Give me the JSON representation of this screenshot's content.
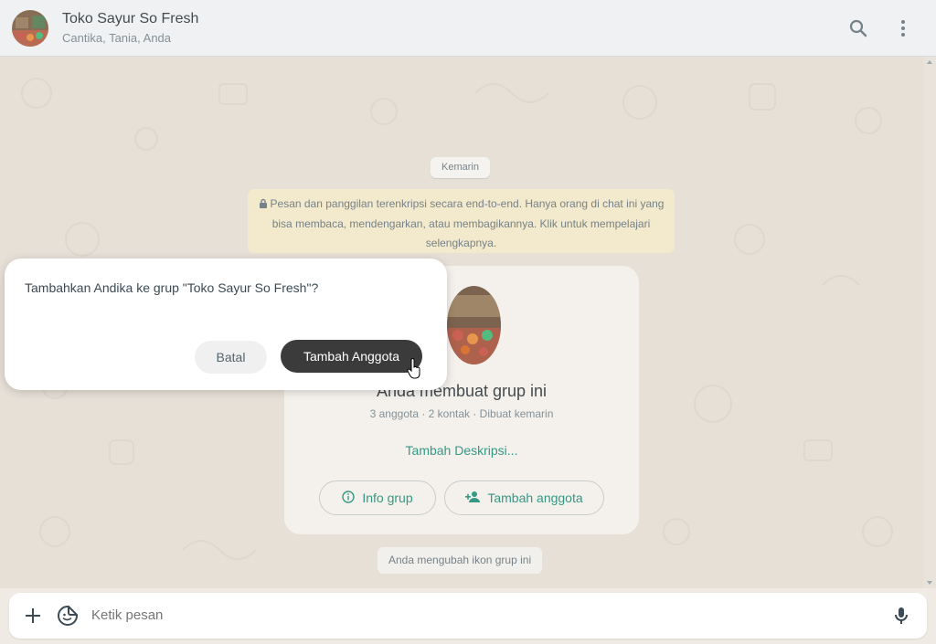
{
  "header": {
    "title": "Toko Sayur So Fresh",
    "subtitle": "Cantika, Tania, Anda",
    "avatar_icon": "group-photo",
    "search_icon": "search-icon",
    "menu_icon": "more-vert-icon"
  },
  "chat": {
    "date_label": "Kemarin",
    "encryption_notice": "Pesan dan panggilan terenkripsi secara end-to-end. Hanya orang di chat ini yang bisa membaca, mendengarkan, atau membagikannya. Klik untuk mempelajari selengkapnya.",
    "group_card": {
      "title": "Anda membuat grup ini",
      "meta": "3 anggota · 2 kontak · Dibuat kemarin",
      "add_description": "Tambah Deskripsi...",
      "info_button": "Info grup",
      "add_member_button": "Tambah anggota"
    },
    "system_message": "Anda mengubah ikon grup ini"
  },
  "dialog": {
    "message": "Tambahkan Andika ke grup \"Toko Sayur So Fresh\"?",
    "cancel_label": "Batal",
    "confirm_label": "Tambah Anggota"
  },
  "composer": {
    "placeholder": "Ketik pesan",
    "plus_icon": "plus-icon",
    "sticker_icon": "sticker-icon",
    "mic_icon": "mic-icon"
  },
  "colors": {
    "accent": "#008069",
    "header_bg": "#f0f2f5",
    "chat_bg": "#e3ddd3",
    "notice_bg": "#f4e8c4",
    "dialog_primary": "#3b3b3b"
  }
}
